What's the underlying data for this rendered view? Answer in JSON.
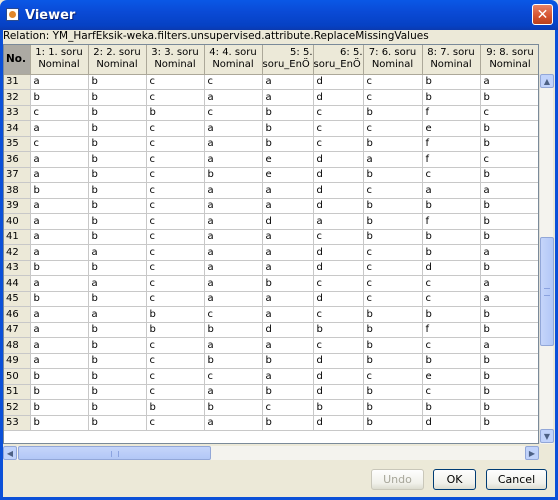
{
  "window": {
    "title": "Viewer",
    "close_glyph": "✕"
  },
  "relation": "Relation: YM_HarfEksik-weka.filters.unsupervised.attribute.ReplaceMissingValues",
  "table": {
    "columns": [
      {
        "name": "No.",
        "type": ""
      },
      {
        "name": "1: 1. soru",
        "type": "Nominal"
      },
      {
        "name": "2: 2. soru",
        "type": "Nominal"
      },
      {
        "name": "3: 3. soru",
        "type": "Nominal"
      },
      {
        "name": "4: 4. soru",
        "type": "Nominal"
      },
      {
        "name": "5: 5.",
        "type": "soru_EnÖ"
      },
      {
        "name": "6: 5.",
        "type": "soru_EnÖ"
      },
      {
        "name": "7: 6. soru",
        "type": "Nominal"
      },
      {
        "name": "8: 7. soru",
        "type": "Nominal"
      },
      {
        "name": "9: 8. soru",
        "type": "Nominal"
      }
    ],
    "rows": [
      [
        "31",
        "a",
        "b",
        "c",
        "c",
        "a",
        "d",
        "c",
        "b",
        "a"
      ],
      [
        "32",
        "b",
        "b",
        "c",
        "a",
        "a",
        "d",
        "c",
        "b",
        "b"
      ],
      [
        "33",
        "c",
        "b",
        "b",
        "c",
        "b",
        "c",
        "b",
        "f",
        "c"
      ],
      [
        "34",
        "a",
        "b",
        "c",
        "a",
        "b",
        "c",
        "c",
        "e",
        "b"
      ],
      [
        "35",
        "c",
        "b",
        "c",
        "a",
        "b",
        "c",
        "b",
        "f",
        "b"
      ],
      [
        "36",
        "a",
        "b",
        "c",
        "a",
        "e",
        "d",
        "a",
        "f",
        "c"
      ],
      [
        "37",
        "a",
        "b",
        "c",
        "b",
        "e",
        "d",
        "b",
        "c",
        "b"
      ],
      [
        "38",
        "b",
        "b",
        "c",
        "a",
        "a",
        "d",
        "c",
        "a",
        "a"
      ],
      [
        "39",
        "a",
        "b",
        "c",
        "a",
        "a",
        "d",
        "b",
        "b",
        "b"
      ],
      [
        "40",
        "a",
        "b",
        "c",
        "a",
        "d",
        "a",
        "b",
        "f",
        "b"
      ],
      [
        "41",
        "a",
        "b",
        "c",
        "a",
        "a",
        "c",
        "b",
        "b",
        "b"
      ],
      [
        "42",
        "a",
        "a",
        "c",
        "a",
        "a",
        "d",
        "c",
        "b",
        "a"
      ],
      [
        "43",
        "b",
        "b",
        "c",
        "a",
        "a",
        "d",
        "c",
        "d",
        "b"
      ],
      [
        "44",
        "a",
        "a",
        "c",
        "a",
        "b",
        "c",
        "c",
        "c",
        "a"
      ],
      [
        "45",
        "b",
        "b",
        "c",
        "a",
        "a",
        "d",
        "c",
        "c",
        "a"
      ],
      [
        "46",
        "a",
        "a",
        "b",
        "c",
        "a",
        "c",
        "b",
        "b",
        "b"
      ],
      [
        "47",
        "a",
        "b",
        "b",
        "b",
        "d",
        "b",
        "b",
        "f",
        "b"
      ],
      [
        "48",
        "a",
        "b",
        "c",
        "a",
        "a",
        "c",
        "b",
        "c",
        "a"
      ],
      [
        "49",
        "a",
        "b",
        "c",
        "b",
        "b",
        "d",
        "b",
        "b",
        "b"
      ],
      [
        "50",
        "b",
        "b",
        "c",
        "c",
        "a",
        "d",
        "c",
        "e",
        "b"
      ],
      [
        "51",
        "b",
        "b",
        "c",
        "a",
        "b",
        "d",
        "b",
        "c",
        "b"
      ],
      [
        "52",
        "b",
        "b",
        "b",
        "b",
        "c",
        "b",
        "b",
        "b",
        "b"
      ],
      [
        "53",
        "b",
        "b",
        "c",
        "a",
        "b",
        "d",
        "b",
        "d",
        "b"
      ]
    ]
  },
  "scroll": {
    "up_glyph": "▲",
    "down_glyph": "▼",
    "left_glyph": "◀",
    "right_glyph": "▶"
  },
  "buttons": {
    "undo": "Undo",
    "ok": "OK",
    "cancel": "Cancel"
  }
}
